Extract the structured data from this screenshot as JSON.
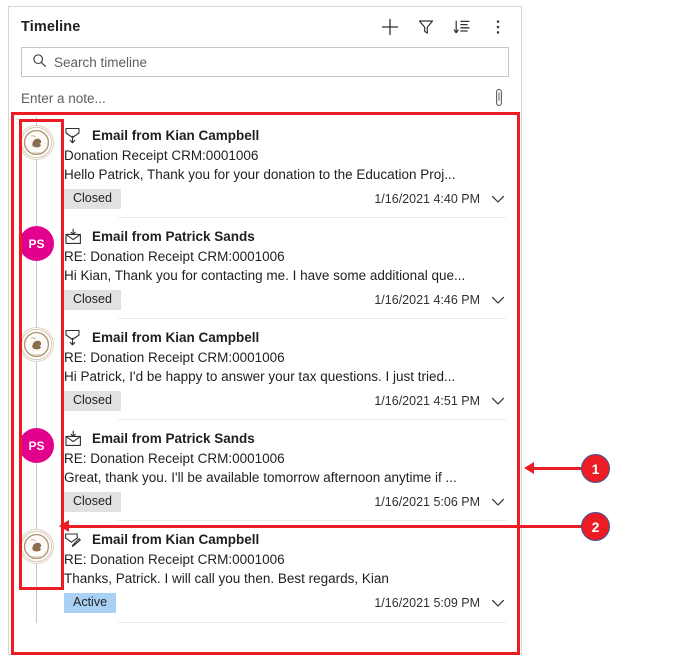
{
  "panel": {
    "title": "Timeline",
    "header_actions": [
      {
        "name": "add-record-button",
        "icon": "plus-icon",
        "label": "Add"
      },
      {
        "name": "filter-button",
        "icon": "filter-funnel-icon",
        "label": "Filter"
      },
      {
        "name": "sort-button",
        "icon": "sort-descending-icon",
        "label": "Sort"
      },
      {
        "name": "more-commands-button",
        "icon": "more-vertical-icon",
        "label": "More commands"
      }
    ]
  },
  "search": {
    "placeholder": "Search timeline",
    "value": "",
    "icon": "search-icon"
  },
  "note": {
    "placeholder": "Enter a note...",
    "value": "",
    "attach_icon": "paperclip-icon"
  },
  "entries": [
    {
      "avatar_type": "logo",
      "avatar_initials": "",
      "mail_icon": "email-sent-icon",
      "title": "Email from Kian Campbell",
      "subject": "Donation Receipt CRM:0001006",
      "preview": "Hello Patrick,   Thank you for your donation to the Education Proj...",
      "status": "Closed",
      "status_kind": "closed",
      "timestamp": "1/16/2021 4:40 PM",
      "chevron": "chevron-down-icon"
    },
    {
      "avatar_type": "initials",
      "avatar_initials": "PS",
      "mail_icon": "email-received-icon",
      "title": "Email from Patrick Sands",
      "subject": "RE: Donation Receipt CRM:0001006",
      "preview": "Hi Kian, Thank you for contacting me. I have some additional que...",
      "status": "Closed",
      "status_kind": "closed",
      "timestamp": "1/16/2021 4:46 PM",
      "chevron": "chevron-down-icon"
    },
    {
      "avatar_type": "logo",
      "avatar_initials": "",
      "mail_icon": "email-sent-icon",
      "title": "Email from Kian Campbell",
      "subject": "RE: Donation Receipt CRM:0001006",
      "preview": "Hi Patrick,   I'd be happy to answer your tax questions. I just tried...",
      "status": "Closed",
      "status_kind": "closed",
      "timestamp": "1/16/2021 4:51 PM",
      "chevron": "chevron-down-icon"
    },
    {
      "avatar_type": "initials",
      "avatar_initials": "PS",
      "mail_icon": "email-received-icon",
      "title": "Email from Patrick Sands",
      "subject": "RE: Donation Receipt CRM:0001006",
      "preview": "Great, thank you. I'll be available tomorrow afternoon anytime if ...",
      "status": "Closed",
      "status_kind": "closed",
      "timestamp": "1/16/2021 5:06 PM",
      "chevron": "chevron-down-icon"
    },
    {
      "avatar_type": "logo",
      "avatar_initials": "",
      "mail_icon": "email-draft-icon",
      "title": "Email from Kian Campbell",
      "subject": "RE: Donation Receipt CRM:0001006",
      "preview": "Thanks, Patrick. I will call you then.   Best regards, Kian",
      "status": "Active",
      "status_kind": "active",
      "timestamp": "1/16/2021 5:09 PM",
      "chevron": "chevron-down-icon"
    }
  ],
  "annotations": {
    "callouts": [
      {
        "number": "1"
      },
      {
        "number": "2"
      }
    ]
  },
  "colors": {
    "annotation_red": "#ec1c24",
    "avatar_magenta": "#e3008c",
    "status_closed_bg": "#e1e1e1",
    "status_active_bg": "#a8d1f5",
    "panel_border": "#d6d6d6"
  }
}
